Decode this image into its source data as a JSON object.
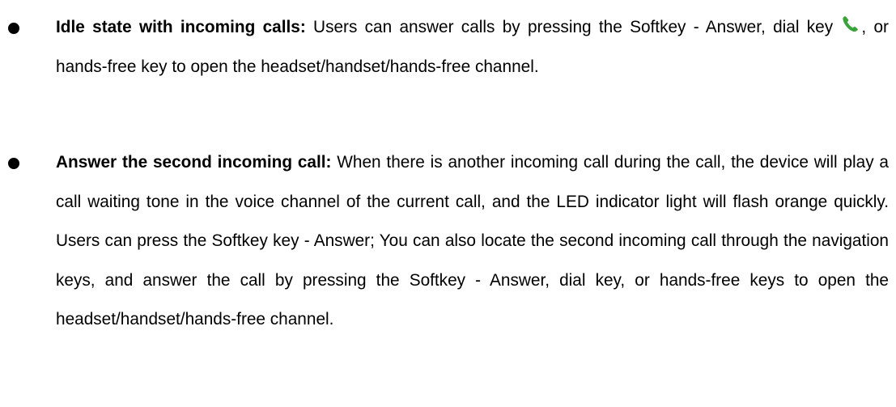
{
  "items": [
    {
      "lead": "Idle state with incoming calls:",
      "text_before_icon": " Users can answer calls by pressing the Softkey - Answer, dial key ",
      "icon": "green-phone-handset-icon",
      "text_after_icon": ", or hands-free key to open the headset/handset/hands-free channel."
    },
    {
      "lead": "Answer the second incoming call:",
      "text": " When there is another incoming call during the call, the device will play a call waiting tone in the voice channel of the current call, and the LED indicator light will flash orange quickly. Users can press the Softkey key - Answer; You can also locate the second incoming call through the navigation keys, and answer the call by pressing the Softkey - Answer, dial key, or hands-free keys to open the headset/handset/hands-free channel."
    }
  ],
  "colors": {
    "text": "#000000",
    "bullet": "#000000",
    "phone_icon": "#3aa33a"
  }
}
